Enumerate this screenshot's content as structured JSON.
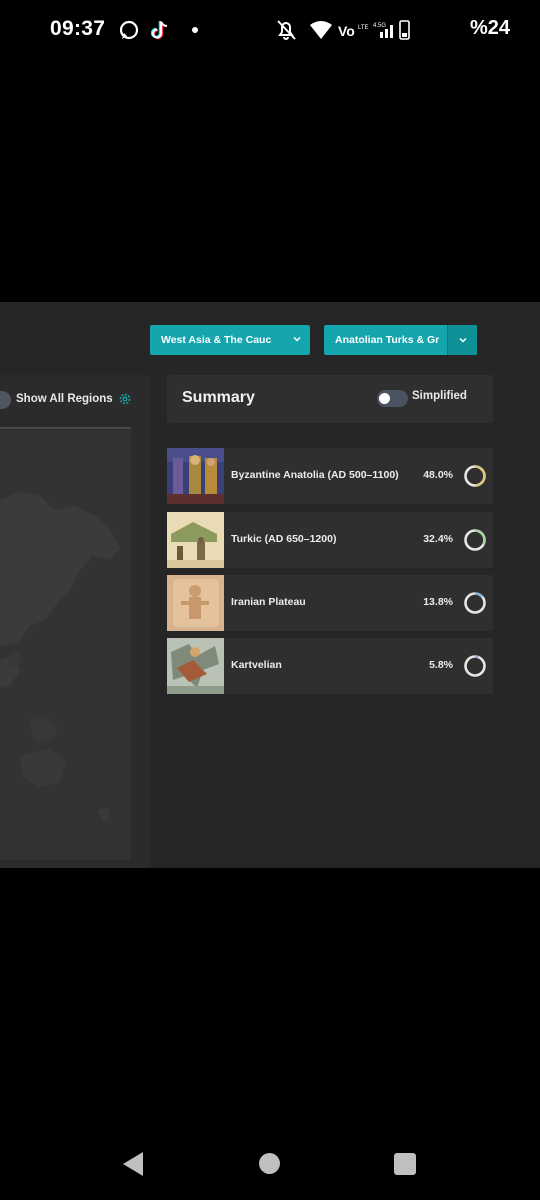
{
  "status_bar": {
    "time": "09:37",
    "battery": "%24",
    "icons": [
      "whatsapp-icon",
      "tiktok-icon",
      "dot-icon",
      "mute-icon",
      "wifi-icon",
      "volte-icon",
      "signal-icon",
      "battery-icon"
    ]
  },
  "filters": {
    "region_dropdown": "West Asia & The Cauc",
    "population_dropdown": "Anatolian Turks & Gr"
  },
  "map_panel": {
    "show_all_label": "Show All Regions"
  },
  "summary": {
    "title": "Summary",
    "simplified_label": "Simplified",
    "rows": [
      {
        "name": "Byzantine Anatolia (AD 500–1100)",
        "percent": "48.0%",
        "value": 0.48,
        "color": "#d8c77a"
      },
      {
        "name": "Turkic (AD 650–1200)",
        "percent": "32.4%",
        "value": 0.324,
        "color": "#a6d4a0"
      },
      {
        "name": "Iranian Plateau",
        "percent": "13.8%",
        "value": 0.138,
        "color": "#7fb3e0"
      },
      {
        "name": "Kartvelian",
        "percent": "5.8%",
        "value": 0.058,
        "color": "#9fb5d8"
      }
    ]
  },
  "colors": {
    "accent": "#14a5ad",
    "panel": "#262626",
    "row": "#2f2f2f"
  }
}
